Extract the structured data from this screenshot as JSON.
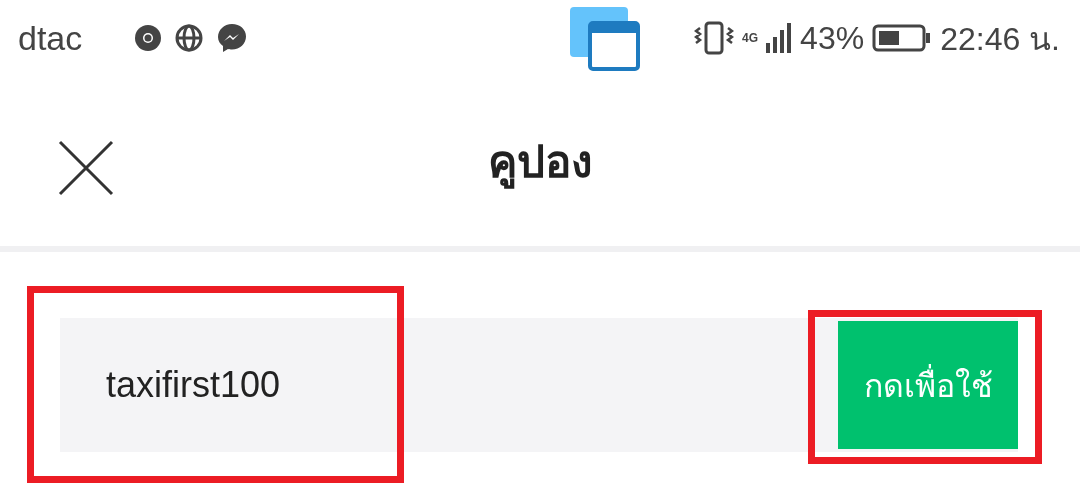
{
  "status_bar": {
    "carrier": "dtac",
    "network": "4G",
    "battery": "43%",
    "time": "22:46 น."
  },
  "header": {
    "title": "คูปอง"
  },
  "coupon": {
    "value": "taxifirst100",
    "button": "กดเพื่อใช้"
  }
}
